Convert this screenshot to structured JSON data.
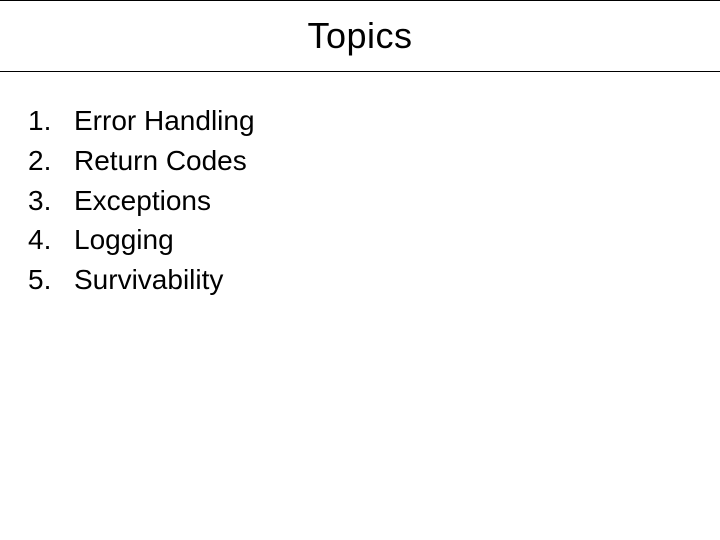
{
  "slide": {
    "title": "Topics",
    "items": [
      {
        "number": "1.",
        "text": "Error Handling"
      },
      {
        "number": "2.",
        "text": "Return Codes"
      },
      {
        "number": "3.",
        "text": "Exceptions"
      },
      {
        "number": "4.",
        "text": "Logging"
      },
      {
        "number": "5.",
        "text": "Survivability"
      }
    ]
  }
}
